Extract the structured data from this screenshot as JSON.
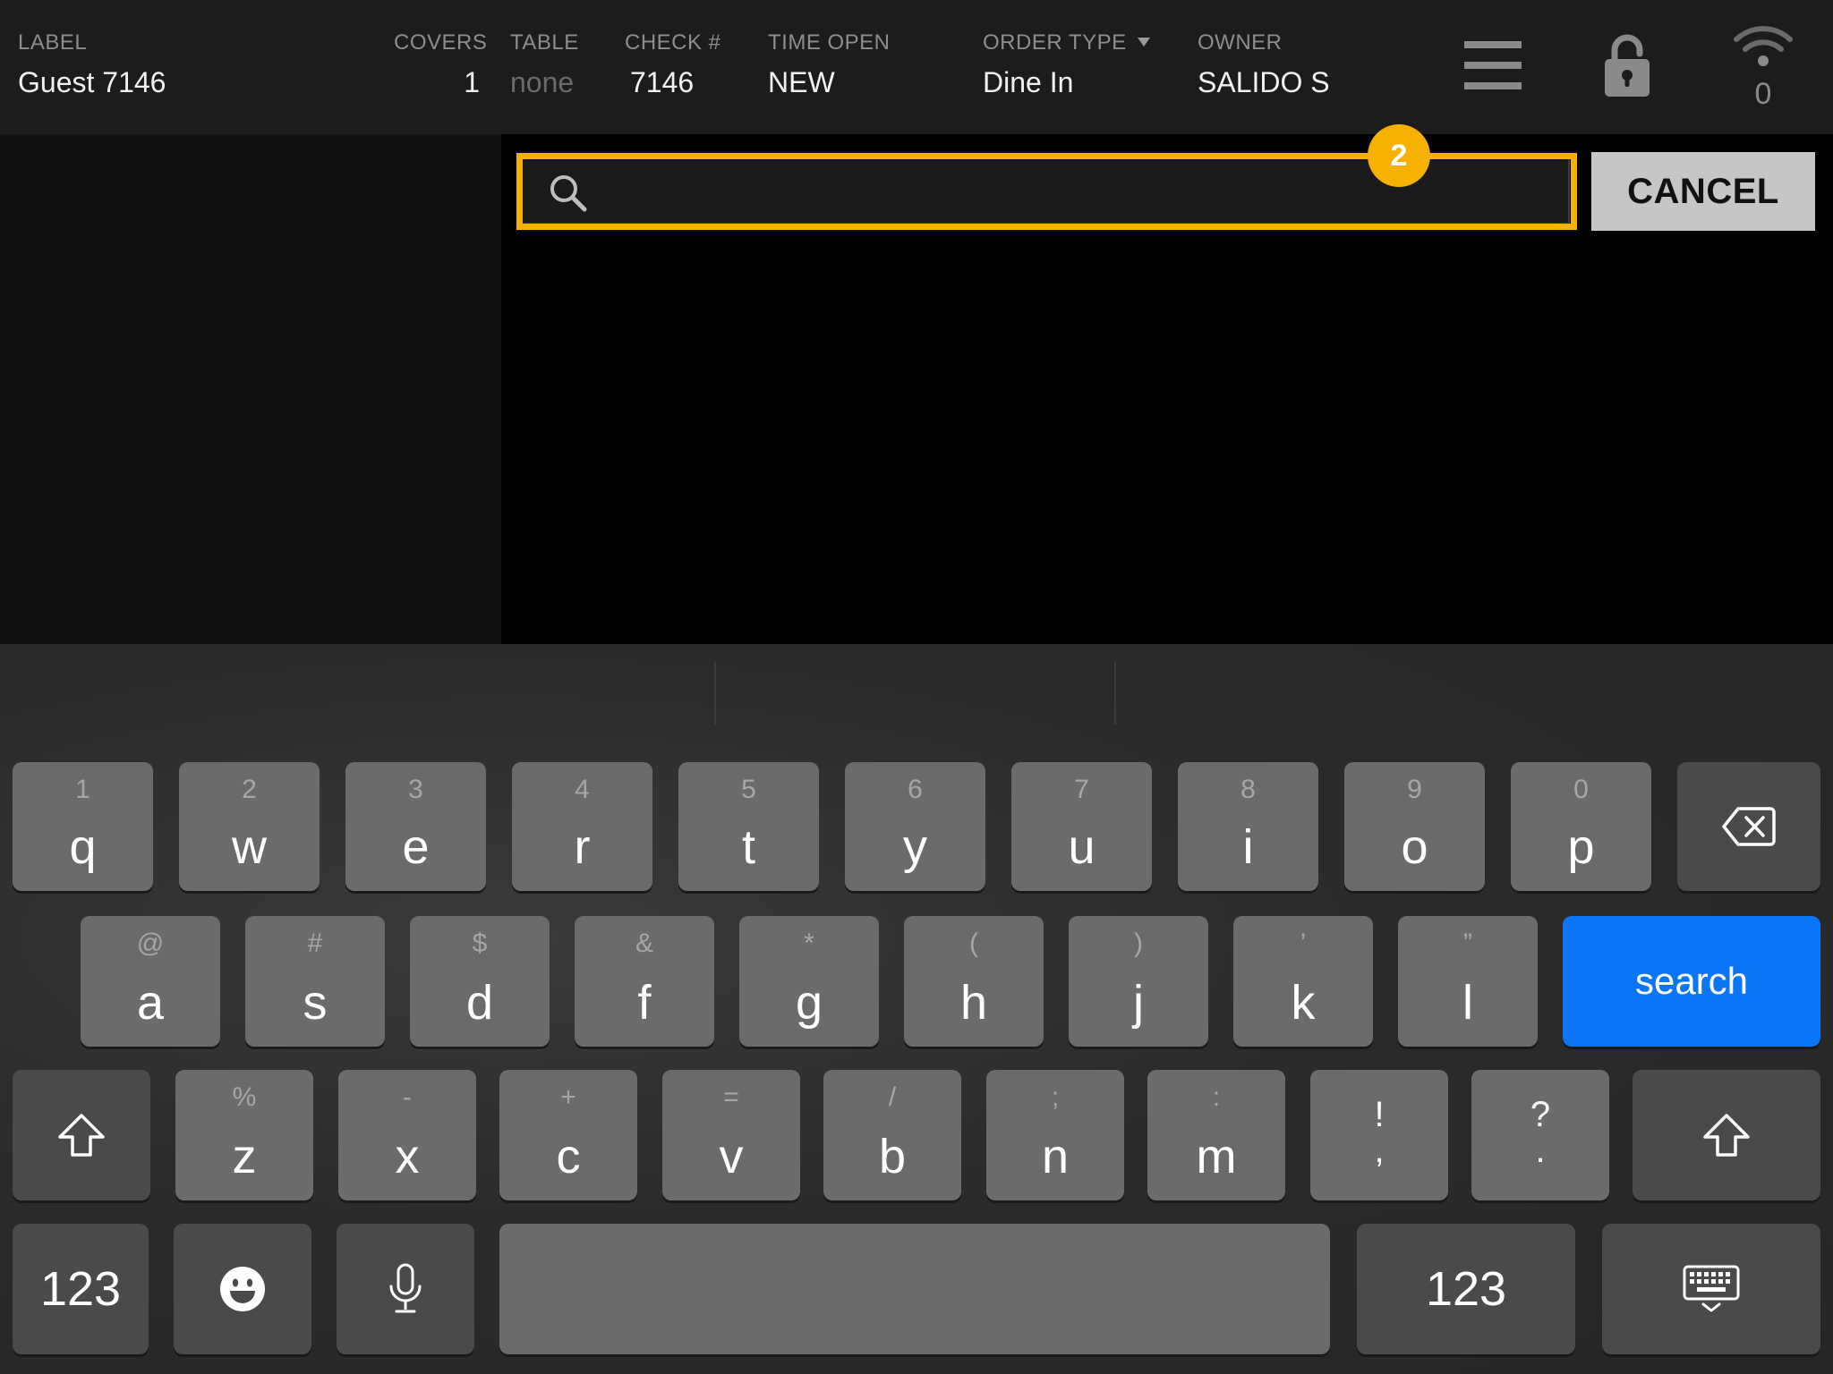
{
  "header": {
    "label": {
      "title": "LABEL",
      "value": "Guest 7146"
    },
    "covers": {
      "title": "COVERS",
      "value": "1"
    },
    "table": {
      "title": "TABLE",
      "value": "none"
    },
    "check": {
      "title": "CHECK #",
      "value": "7146"
    },
    "time_open": {
      "title": "TIME OPEN",
      "value": "NEW"
    },
    "order_type": {
      "title": "ORDER TYPE",
      "value": "Dine In"
    },
    "owner": {
      "title": "OWNER",
      "value": "SALIDO S"
    },
    "icons": {
      "menu": "hamburger-menu-icon",
      "lock": "lock-icon",
      "wifi": "wifi-icon"
    },
    "wifi_count": "0"
  },
  "search": {
    "placeholder": "",
    "value": "",
    "icon": "search-icon",
    "cancel_label": "CANCEL",
    "badge": "2",
    "highlight_color": "#f5b000"
  },
  "keyboard": {
    "row1": [
      {
        "alt": "1",
        "main": "q"
      },
      {
        "alt": "2",
        "main": "w"
      },
      {
        "alt": "3",
        "main": "e"
      },
      {
        "alt": "4",
        "main": "r"
      },
      {
        "alt": "5",
        "main": "t"
      },
      {
        "alt": "6",
        "main": "y"
      },
      {
        "alt": "7",
        "main": "u"
      },
      {
        "alt": "8",
        "main": "i"
      },
      {
        "alt": "9",
        "main": "o"
      },
      {
        "alt": "0",
        "main": "p"
      }
    ],
    "row2": [
      {
        "alt": "@",
        "main": "a"
      },
      {
        "alt": "#",
        "main": "s"
      },
      {
        "alt": "$",
        "main": "d"
      },
      {
        "alt": "&",
        "main": "f"
      },
      {
        "alt": "*",
        "main": "g"
      },
      {
        "alt": "(",
        "main": "h"
      },
      {
        "alt": ")",
        "main": "j"
      },
      {
        "alt": "’",
        "main": "k"
      },
      {
        "alt": "”",
        "main": "l"
      }
    ],
    "row3": [
      {
        "alt": "%",
        "main": "z"
      },
      {
        "alt": "-",
        "main": "x"
      },
      {
        "alt": "+",
        "main": "c"
      },
      {
        "alt": "=",
        "main": "v"
      },
      {
        "alt": "/",
        "main": "b"
      },
      {
        "alt": ";",
        "main": "n"
      },
      {
        "alt": ":",
        "main": "m"
      }
    ],
    "row3_punct": [
      {
        "top": "!",
        "bottom": ","
      },
      {
        "top": "?",
        "bottom": "."
      }
    ],
    "search_label": "search",
    "numbers_label": "123",
    "icons": {
      "backspace": "backspace-icon",
      "shift": "shift-icon",
      "emoji": "emoji-icon",
      "microphone": "microphone-icon",
      "hide_keyboard": "keyboard-dismiss-icon"
    },
    "colors": {
      "search_key": "#0a76f5",
      "letter_key": "#6b6b6b",
      "function_key": "#4a4a4a"
    }
  }
}
